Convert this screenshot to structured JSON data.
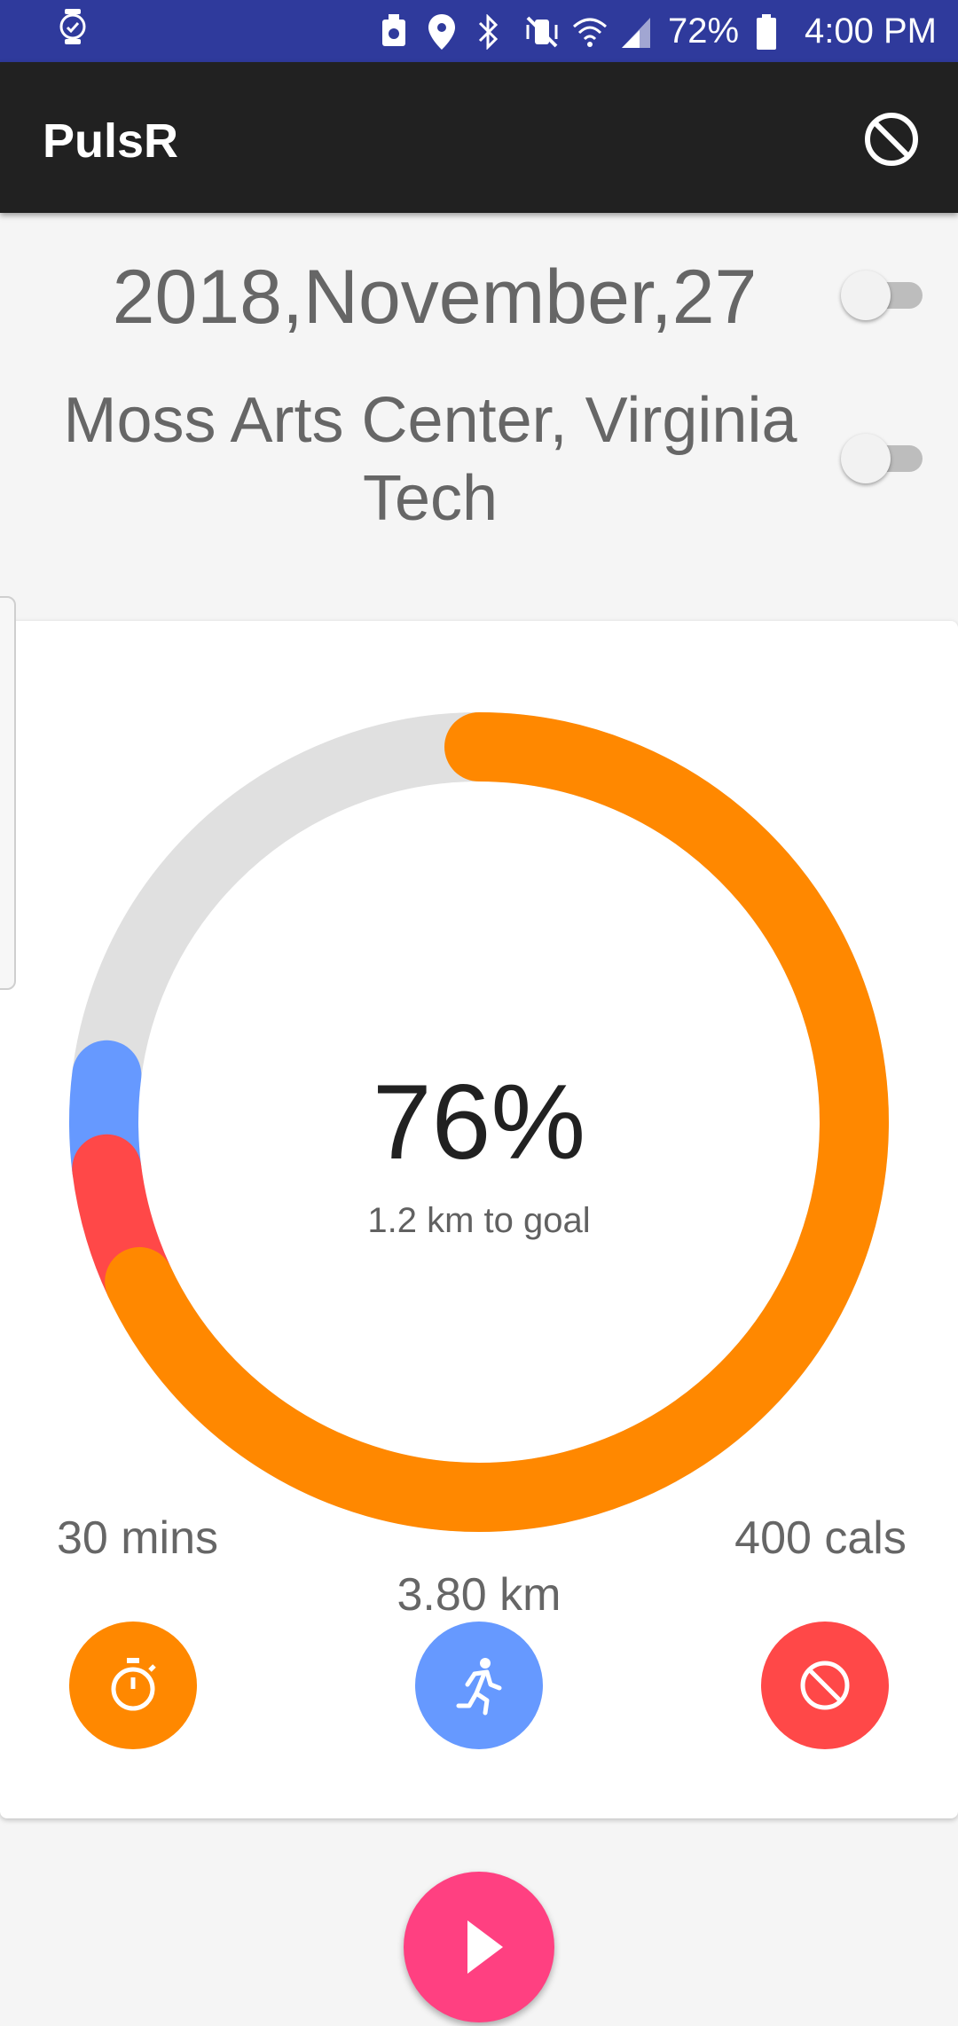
{
  "status_bar": {
    "battery_percent": "72%",
    "time": "4:00 PM",
    "background_color": "#2f3a9c",
    "icons": [
      "watch-icon",
      "storage-icon",
      "location-icon",
      "bluetooth-icon",
      "vibrate-mute-icon",
      "wifi-icon",
      "signal-icon",
      "battery-icon"
    ]
  },
  "app_bar": {
    "title": "PulsR",
    "action_icon": "block-icon",
    "background_color": "#212121"
  },
  "filters": {
    "date": "2018,November,27",
    "date_toggle_on": false,
    "location": "Moss Arts Center, Virginia Tech",
    "location_toggle_on": false
  },
  "progress": {
    "percent_label": "76%",
    "subtitle": "1.2 km to goal",
    "ring_segments": [
      {
        "name": "distance",
        "color": "#ff8800",
        "fraction": 0.68
      },
      {
        "name": "calories",
        "color": "#ff4848",
        "fraction": 0.05
      },
      {
        "name": "time",
        "color": "#6699ff",
        "fraction": 0.04
      }
    ],
    "track_color": "#e0e0e0"
  },
  "stats": [
    {
      "label": "30 mins",
      "icon": "stopwatch-icon",
      "color": "#ff8800"
    },
    {
      "label": "3.80 km",
      "icon": "running-icon",
      "color": "#6699ff"
    },
    {
      "label": "400 cals",
      "icon": "block-icon",
      "color": "#ff4848"
    }
  ],
  "fab": {
    "icon": "play-icon",
    "color": "#ff4081"
  }
}
